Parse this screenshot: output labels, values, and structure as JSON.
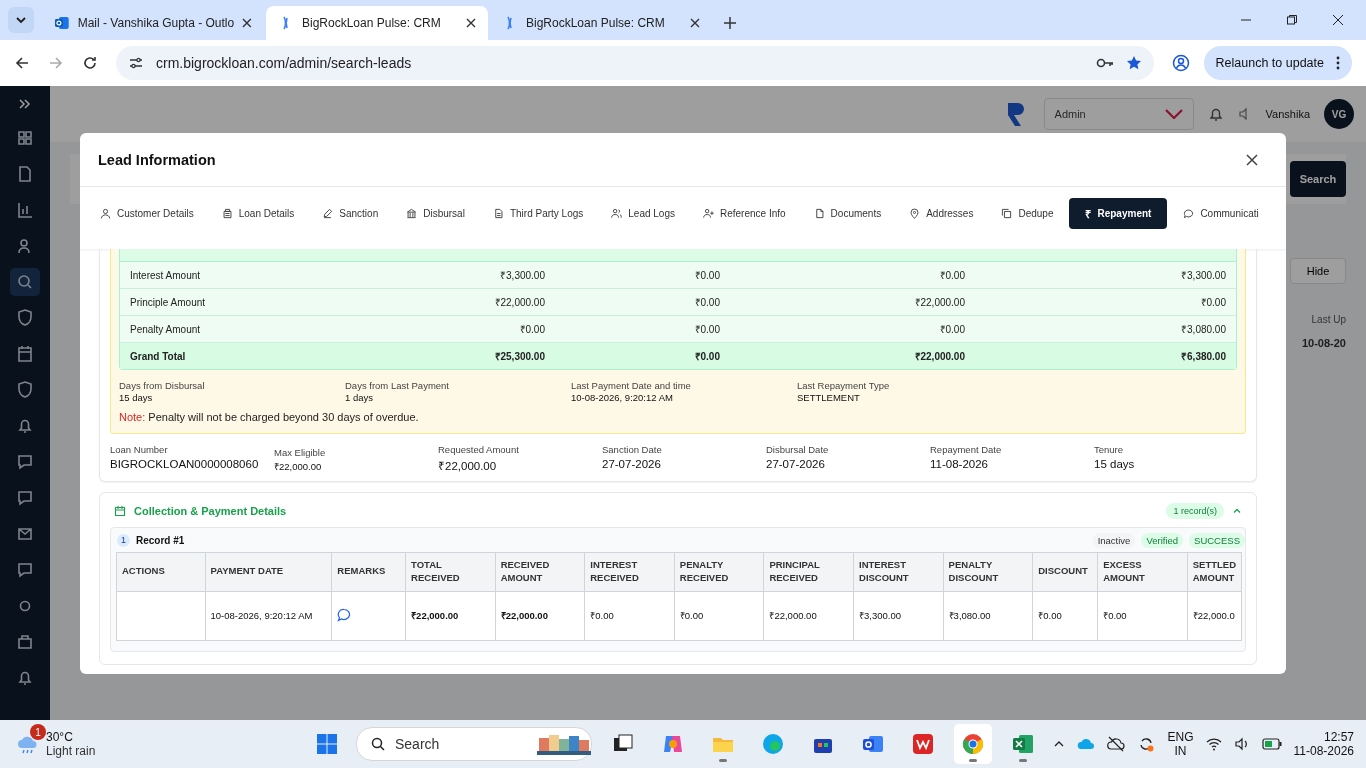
{
  "browser": {
    "tabs": [
      {
        "title": "Mail - Vanshika Gupta - Outlo",
        "selected": false,
        "kind": "mail"
      },
      {
        "title": "BigRockLoan Pulse: CRM",
        "selected": true,
        "kind": "crm"
      },
      {
        "title": "BigRockLoan Pulse: CRM",
        "selected": false,
        "kind": "crm"
      }
    ],
    "url": "crm.bigrockloan.com/admin/search-leads",
    "relaunch": "Relaunch to update"
  },
  "app": {
    "role": "Admin",
    "user": "Vanshika",
    "avatar": "VG",
    "search_button": "Search",
    "hide_button": "Hide",
    "last_updated_label": "Last Up",
    "last_updated_value": "10-08-20"
  },
  "modal": {
    "title": "Lead Information",
    "tabs": [
      {
        "label": "Customer Details",
        "selected": false
      },
      {
        "label": "Loan Details",
        "selected": false
      },
      {
        "label": "Sanction",
        "selected": false
      },
      {
        "label": "Disbursal",
        "selected": false
      },
      {
        "label": "Third Party Logs",
        "selected": false
      },
      {
        "label": "Lead Logs",
        "selected": false
      },
      {
        "label": "Reference Info",
        "selected": false
      },
      {
        "label": "Documents",
        "selected": false
      },
      {
        "label": "Addresses",
        "selected": false
      },
      {
        "label": "Dedupe",
        "selected": false
      },
      {
        "label": "Repayment",
        "selected": true,
        "icon_char": "₹"
      },
      {
        "label": "Communicati",
        "selected": false
      }
    ],
    "amounts": [
      {
        "kind": "row",
        "cells": [
          "Interest Amount",
          "₹3,300.00",
          "₹0.00",
          "₹0.00",
          "₹3,300.00"
        ]
      },
      {
        "kind": "row",
        "cells": [
          "Principle Amount",
          "₹22,000.00",
          "₹0.00",
          "₹22,000.00",
          "₹0.00"
        ]
      },
      {
        "kind": "row",
        "cells": [
          "Penalty Amount",
          "₹0.00",
          "₹0.00",
          "₹0.00",
          "₹3,080.00"
        ]
      },
      {
        "kind": "total",
        "cells": [
          "Grand Total",
          "₹25,300.00",
          "₹0.00",
          "₹22,000.00",
          "₹6,380.00"
        ]
      }
    ],
    "summary": [
      {
        "label": "Days from Disbursal",
        "value": "15 days"
      },
      {
        "label": "Days from Last Payment",
        "value": "1 days"
      },
      {
        "label": "Last Payment Date and time",
        "value": "10-08-2026, 9:20:12 AM"
      },
      {
        "label": "Last Repayment Type",
        "value": "SETTLEMENT"
      }
    ],
    "note": {
      "label": "Note:",
      "text": "Penalty will not be charged beyond 30 days of overdue."
    },
    "loan_info": [
      {
        "label": "Loan Number",
        "value": "BIGROCKLOAN0000008060",
        "kind": "main"
      },
      {
        "label": "Max Eligible",
        "value": "₹22,000.00",
        "kind": "small"
      },
      {
        "label": "Requested Amount",
        "value": "₹22,000.00",
        "kind": "main"
      },
      {
        "label": "Sanction Date",
        "value": "27-07-2026",
        "kind": "main"
      },
      {
        "label": "Disbursal Date",
        "value": "27-07-2026",
        "kind": "main"
      },
      {
        "label": "Repayment Date",
        "value": "11-08-2026",
        "kind": "main"
      },
      {
        "label": "Tenure",
        "value": "15 days",
        "kind": "main"
      }
    ],
    "collection": {
      "title": "Collection & Payment Details",
      "count": "1 record(s)",
      "expanded": true,
      "record": {
        "number": "1",
        "title": "Record #1",
        "badges": [
          {
            "label": "Inactive",
            "kind": "neutral"
          },
          {
            "label": "Verified",
            "kind": "success"
          },
          {
            "label": "SUCCESS",
            "kind": "success"
          }
        ]
      },
      "columns": [
        "ACTIONS",
        "PAYMENT DATE",
        "REMARKS",
        "TOTAL RECEIVED",
        "RECEIVED AMOUNT",
        "INTEREST RECEIVED",
        "PENALTY RECEIVED",
        "PRINCIPAL RECEIVED",
        "INTEREST DISCOUNT",
        "PENALTY DISCOUNT",
        "DISCOUNT",
        "EXCESS AMOUNT",
        "SETTLED AMOUNT"
      ],
      "rows": [
        {
          "cells": [
            {
              "kind": "empty"
            },
            {
              "kind": "text",
              "text": "10-08-2026, 9:20:12 AM",
              "bold": false
            },
            {
              "kind": "remarks"
            },
            {
              "kind": "text",
              "text": "₹22,000.00",
              "bold": true
            },
            {
              "kind": "text",
              "text": "₹22,000.00",
              "bold": true
            },
            {
              "kind": "text",
              "text": "₹0.00",
              "bold": false
            },
            {
              "kind": "text",
              "text": "₹0.00",
              "bold": false
            },
            {
              "kind": "text",
              "text": "₹22,000.00",
              "bold": false
            },
            {
              "kind": "text",
              "text": "₹3,300.00",
              "bold": false
            },
            {
              "kind": "text",
              "text": "₹3,080.00",
              "bold": false
            },
            {
              "kind": "text",
              "text": "₹0.00",
              "bold": false
            },
            {
              "kind": "text",
              "text": "₹0.00",
              "bold": false
            },
            {
              "kind": "text",
              "text": "₹22,000.0",
              "bold": false
            }
          ]
        }
      ]
    }
  },
  "taskbar": {
    "weather": {
      "badge": "1",
      "temp": "30°C",
      "condition": "Light rain"
    },
    "search": "Search",
    "apps": [
      {
        "kind": "taskview",
        "running": false,
        "selected": false
      },
      {
        "kind": "copilot",
        "running": false,
        "selected": false
      },
      {
        "kind": "folder",
        "running": true,
        "selected": false
      },
      {
        "kind": "edge",
        "running": false,
        "selected": false
      },
      {
        "kind": "store",
        "running": false,
        "selected": false
      },
      {
        "kind": "outlook",
        "running": false,
        "selected": false
      },
      {
        "kind": "wps",
        "running": false,
        "selected": false
      },
      {
        "kind": "chrome",
        "running": true,
        "selected": true
      },
      {
        "kind": "excel",
        "running": true,
        "selected": false
      }
    ],
    "lang": "ENG",
    "region": "IN",
    "time": "12:57",
    "date": "11-08-2026"
  }
}
